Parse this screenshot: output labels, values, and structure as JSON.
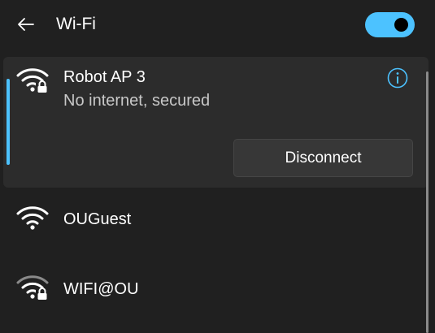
{
  "header": {
    "title": "Wi-Fi",
    "wifi_enabled": true,
    "toggle_color": "#4cc2ff"
  },
  "networks": [
    {
      "name": "Robot AP 3",
      "status": "No internet, secured",
      "secured": true,
      "connected": true,
      "icon": "wifi-secured-icon",
      "action_label": "Disconnect"
    },
    {
      "name": "OUGuest",
      "secured": false,
      "connected": false,
      "icon": "wifi-icon"
    },
    {
      "name": "WIFI@OU",
      "secured": true,
      "connected": false,
      "icon": "wifi-secured-icon"
    }
  ],
  "colors": {
    "background": "#202020",
    "card": "#2c2c2c",
    "accent": "#4cc2ff",
    "secondary_text": "#c8c8c8"
  }
}
